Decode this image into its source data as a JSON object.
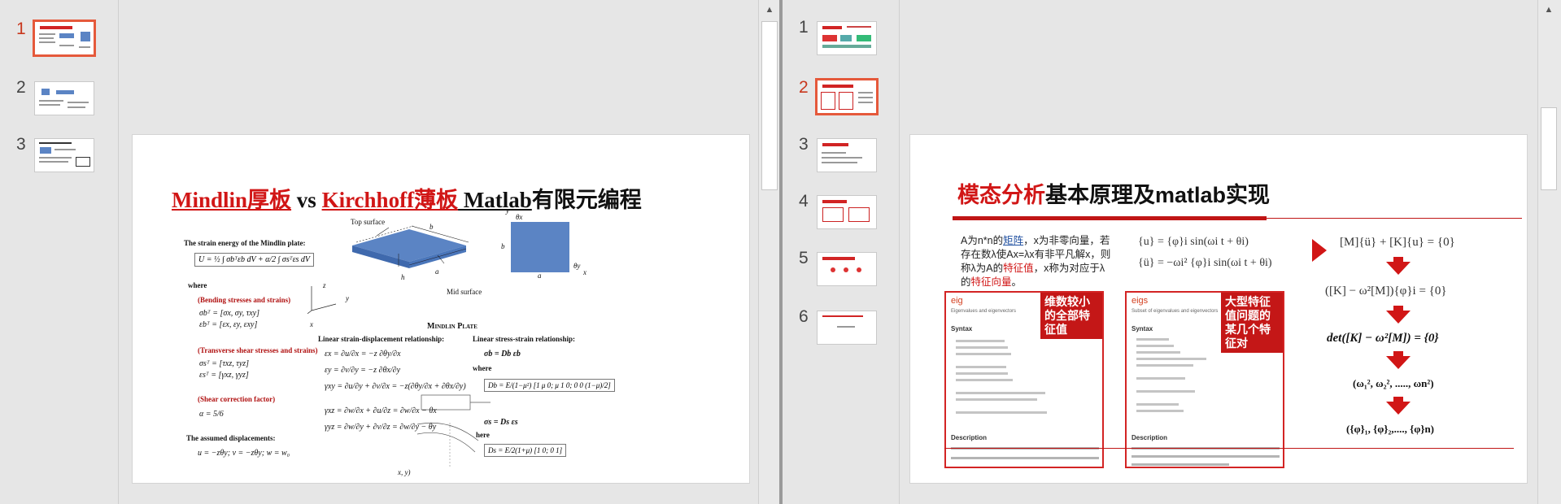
{
  "left_window": {
    "thumbnails": [
      {
        "number": "1",
        "selected": true
      },
      {
        "number": "2",
        "selected": false
      },
      {
        "number": "3",
        "selected": false
      }
    ],
    "slide": {
      "title_part1": "Mindlin厚板",
      "title_part2": " vs ",
      "title_part3": "Kirchhoff薄板",
      "title_part4": " Matlab",
      "title_part5": "有限元编程",
      "strain_energy_heading": "The strain energy of the Mindlin plate:",
      "energy_eq": "U = ½ ∫ σbᵀεb dV + α/2 ∫ σsᵀεs dV",
      "where": "where",
      "bending_label": "(Bending stresses and strains)",
      "bending_eq1": "σbᵀ = [σx, σy, τxy]",
      "bending_eq2": "εbᵀ = [εx, εy, εxy]",
      "shear_label": "(Transverse shear stresses and strains)",
      "shear_eq1": "σsᵀ = [τxz, τyz]",
      "shear_eq2": "εsᵀ = [γxz, γyz]",
      "shear_corr_label": "(Shear correction factor)",
      "alpha_eq": "α = 5/6",
      "displacements_heading": "The assumed displacements:",
      "displacements_eq": "u = −zθy;   v = −zθy;   w = w₀",
      "top_surface": "Top surface",
      "mid_surface": "Mid surface",
      "plate_caption": "Mindlin Plate",
      "dim_a": "a",
      "dim_b": "b",
      "dim_h": "h",
      "axis_x": "x",
      "axis_y": "y",
      "axis_z": "z",
      "theta_x": "θx",
      "theta_y": "θy",
      "linear_strain_heading": "Linear strain-displacement relationship:",
      "linear_stress_heading": "Linear stress-strain relationship:",
      "strain_eq1": "εx = ∂u/∂x = −z ∂θy/∂x",
      "strain_eq2": "εy = ∂v/∂y = −z ∂θx/∂y",
      "strain_eq3": "γxy = ∂u/∂y + ∂v/∂x = −z(∂θy/∂x + ∂θx/∂y)",
      "strain_eq4": "γxz = ∂w/∂x + ∂u/∂z = ∂w/∂x − θx",
      "strain_eq5": "γyz = ∂w/∂y + ∂v/∂z = ∂w/∂y − θy",
      "stress_eq1": "σb = Db εb",
      "stress_where": "where",
      "db_eq": "Db = E/(1−μ²) [1 μ 0; μ 1 0; 0 0 (1−μ)/2]",
      "stress_eq2": "σs = Ds εs",
      "here": "here",
      "ds_eq": "Ds = E/2(1+μ) [1 0; 0 1]",
      "xy_label": "x, y)"
    }
  },
  "right_window": {
    "thumbnails": [
      {
        "number": "1",
        "selected": false
      },
      {
        "number": "2",
        "selected": true
      },
      {
        "number": "3",
        "selected": false
      },
      {
        "number": "4",
        "selected": false
      },
      {
        "number": "5",
        "selected": false
      },
      {
        "number": "6",
        "selected": false
      }
    ],
    "slide": {
      "title_red": "模态分析",
      "title_black": "基本原理及matlab实现",
      "para_1": "A为n*n的",
      "para_link": "矩阵",
      "para_2": "，x为非零向量，若存在数λ使Ax=λx有非平凡解x，则称λ为A的",
      "para_hl1": "特征值",
      "para_3": "，x称为对应于λ的",
      "para_hl2": "特征向量",
      "para_4": "。",
      "eq_u": "{u} = {φ}i sin(ωi t + θi)",
      "eq_u2": "{ü} = −ωi² {φ}i sin(ωi t + θi)",
      "eq_motion": "[M]{ü} + [K]{u} = {0}",
      "eq_char": "([K] − ω²[M]){φ}i = {0}",
      "eq_det": "det([K] − ω²[M]) = {0}",
      "eq_omega": "(ω₁², ω₂², ....., ωn²)",
      "eq_phi": "({φ}₁, {φ}₂,...., {φ}n)",
      "eig_panel": {
        "head": "eig",
        "sub": "Eigenvalues and eigenvectors",
        "syntax": "Syntax",
        "description": "Description",
        "tag": "维数较小的全部特征值"
      },
      "eigs_panel": {
        "head": "eigs",
        "sub": "Subset of eigenvalues and eigenvectors",
        "syntax": "Syntax",
        "description": "Description",
        "tag": "大型特征值问题的某几个特征对"
      }
    }
  },
  "colors": {
    "accent_red": "#d11616",
    "thumb_selected": "#e5593b",
    "plate_blue": "#5b84c4"
  }
}
